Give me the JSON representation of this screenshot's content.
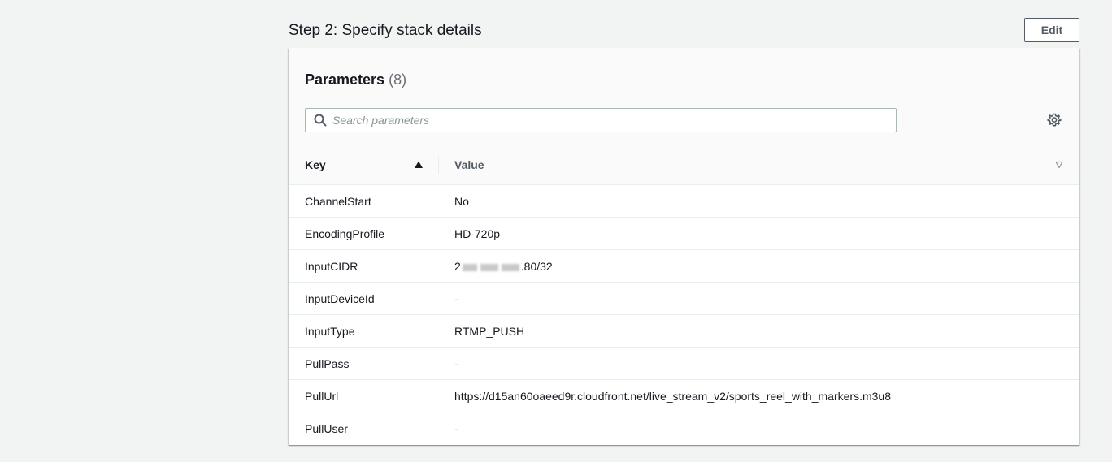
{
  "step": {
    "title": "Step 2: Specify stack details",
    "edit_label": "Edit"
  },
  "parameters": {
    "title": "Parameters",
    "count": "(8)",
    "search_placeholder": "Search parameters",
    "icons": {
      "search": "search-icon",
      "settings": "gear-icon",
      "sort": "sort-ascending-icon",
      "filter": "caret-down-icon"
    },
    "columns": {
      "key": "Key",
      "value": "Value"
    },
    "rows": [
      {
        "key": "ChannelStart",
        "value": "No"
      },
      {
        "key": "EncodingProfile",
        "value": "HD-720p"
      },
      {
        "key": "InputCIDR",
        "value_prefix": "2",
        "value_suffix": ".80/32"
      },
      {
        "key": "InputDeviceId",
        "value": "-"
      },
      {
        "key": "InputType",
        "value": "RTMP_PUSH"
      },
      {
        "key": "PullPass",
        "value": "-"
      },
      {
        "key": "PullUrl",
        "value": "https://d15an60oaeed9r.cloudfront.net/live_stream_v2/sports_reel_with_markers.m3u8"
      },
      {
        "key": "PullUser",
        "value": "-"
      }
    ]
  },
  "colors": {
    "page_bg": "#f2f3f3",
    "panel_bg": "#ffffff",
    "header_bg": "#fafafa",
    "border": "#eaeded",
    "text": "#16191f",
    "muted": "#687078"
  }
}
